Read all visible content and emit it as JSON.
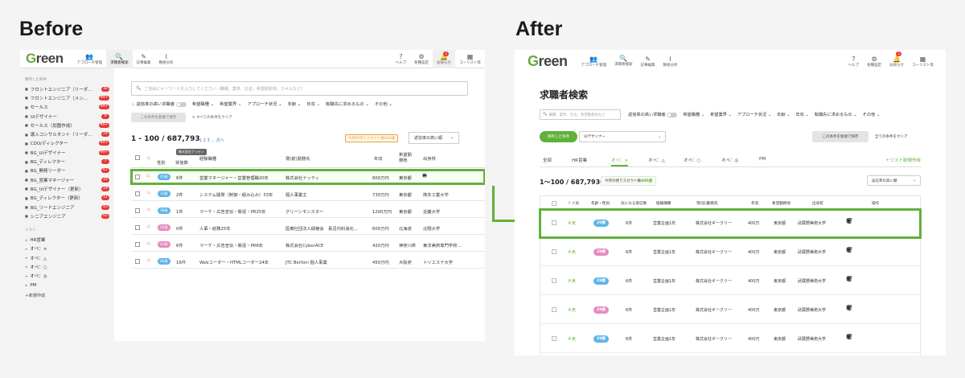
{
  "headings": {
    "before": "Before",
    "after": "After"
  },
  "before": {
    "nav": {
      "logo_g": "G",
      "logo_rest": "reen",
      "items": [
        {
          "label": "アプローチ管理",
          "icon": "people-icon"
        },
        {
          "label": "求職者検索",
          "icon": "search-icon",
          "active": true
        },
        {
          "label": "記事編集",
          "icon": "pen-icon"
        },
        {
          "label": "数値分析",
          "icon": "chart-icon"
        }
      ],
      "right": [
        {
          "label": "ヘルプ",
          "icon": "help-icon"
        },
        {
          "label": "各種設定",
          "icon": "gear-icon"
        },
        {
          "label": "お知らせ",
          "icon": "bell-icon",
          "badge": "2"
        },
        {
          "label": "コーリスト等",
          "icon": "building-icon"
        }
      ]
    },
    "sidebar": {
      "saved_heading": "保存した条件",
      "saved": [
        {
          "label": "フロントエンジニア（リーダ…",
          "count": "30"
        },
        {
          "label": "フロントエンジニア（メン…",
          "count": "99+"
        },
        {
          "label": "セールス",
          "count": "99+"
        },
        {
          "label": "UIデザイナー",
          "count": "9"
        },
        {
          "label": "セールス（加盟作成）",
          "count": "99+"
        },
        {
          "label": "導入コンサルタント（リーダ…",
          "count": "24"
        },
        {
          "label": "CDO/ディレクター",
          "count": "99+"
        },
        {
          "label": "BG_UIデザイナー",
          "count": "99+"
        },
        {
          "label": "BG_ディレクター",
          "count": "7"
        },
        {
          "label": "BG_開発リーダー",
          "count": "67"
        },
        {
          "label": "BG_営業マネージャー",
          "count": "31"
        },
        {
          "label": "BG_UIデザイナー（更新）",
          "count": "24"
        },
        {
          "label": "BG_ディレクター（更新）",
          "count": "11"
        },
        {
          "label": "BG_リードエンジニア",
          "count": "43"
        },
        {
          "label": "シニアエンジニア",
          "count": "62"
        }
      ],
      "list_heading": "リスト",
      "lists": [
        "HR営業",
        "オペ：×",
        "オペ：△",
        "オペ：○",
        "オペ：◎",
        "PM"
      ],
      "add_list": "＋新規作成"
    },
    "search_placeholder": "ご自由にキーワードを入力してください（職種、業界、社名、希望勤務地、スキルなど）",
    "filters": [
      "返信率の高い求職者",
      "希望職種 ⌄",
      "希望業界 ⌄",
      "アプローチ状況 ⌄",
      "年齢 ⌄",
      "年収 ⌄",
      "転職先に求めるもの ⌄",
      "その他 ⌄"
    ],
    "save_btn": "この条件を新規で保存",
    "clear": "すべての条件をクリア",
    "count": "1 - 100 / 687,793",
    "pager": "1 2 3 … 次へ",
    "scout": "今月の残りスカウト数400通",
    "sort": "返信率の高い順",
    "tooltip": "株式会社ナッティ",
    "header": {
      "sex": "性別",
      "received": "受信数",
      "job": "経験職種",
      "company": "現(前)勤務先",
      "salary": "年収",
      "location": "希望勤務地",
      "school": "出身校"
    },
    "rows": [
      {
        "age": "41歳",
        "pink": false,
        "count": "6件",
        "job": "営業マネージャー・営業管理職20年",
        "company": "株式会社ナッティ",
        "salary": "800万円",
        "loc": "東京都",
        "school": "",
        "highlight": true
      },
      {
        "age": "33歳",
        "pink": false,
        "count": "2件",
        "job": "システム開発（制御・組み込み）33年",
        "company": "個人事業主",
        "salary": "730万円",
        "loc": "東京都",
        "school": "熊本工業大学"
      },
      {
        "age": "38歳",
        "pink": false,
        "count": "1件",
        "job": "マーケ・広告宣伝・販促・PR25年",
        "company": "グリーンモンスター",
        "salary": "1200万円",
        "loc": "東京都",
        "school": "近畿大学"
      },
      {
        "age": "52歳",
        "pink": true,
        "count": "0件",
        "job": "人事・総務25年",
        "company": "医療社団法人緑稜会　長沼内科消化…",
        "salary": "600万円",
        "loc": "北海道",
        "school": "北翔大学"
      },
      {
        "age": "44歳",
        "pink": true,
        "count": "6件",
        "job": "マーケ・広告宣伝・販促・PR6年",
        "company": "株式会社CyberACE",
        "salary": "420万円",
        "loc": "神奈川県",
        "school": "東洋美術専門学校…"
      },
      {
        "age": "46歳",
        "pink": false,
        "count": "16件",
        "job": "Webコーダー・HTMLコーダー24年",
        "company": "JTC Berfoni 個人事業",
        "salary": "450万円",
        "loc": "大阪府",
        "school": "トリエステ大学"
      }
    ]
  },
  "after": {
    "nav": {
      "logo_g": "G",
      "logo_rest": "reen",
      "items": [
        {
          "label": "アプローチ管理",
          "icon": "people-icon"
        },
        {
          "label": "求職者検索",
          "icon": "search-icon",
          "active": true
        },
        {
          "label": "記事編集",
          "icon": "pen-icon"
        },
        {
          "label": "数値分析",
          "icon": "chart-icon"
        }
      ],
      "right": [
        {
          "label": "ヘルプ",
          "icon": "help-icon"
        },
        {
          "label": "各種設定",
          "icon": "gear-icon"
        },
        {
          "label": "お知らせ",
          "icon": "bell-icon",
          "badge": "2"
        },
        {
          "label": "コーリスト等",
          "icon": "building-icon"
        }
      ]
    },
    "title": "求職者検索",
    "search_placeholder": "職種、業界、社名、希望勤務地など",
    "filters": [
      "返信率の高い求職者",
      "希望職種 ⌄",
      "希望業界 ⌄",
      "アプローチ状況 ⌄",
      "年齢 ⌄",
      "年収 ⌄",
      "転職先に求めるもの ⌄",
      "その他 ⌄"
    ],
    "saved_btn": "保存した条件",
    "saved_select": "UIデザイナー",
    "save_btn": "この条件を新規で保存",
    "clear": "全ての条件をクリア",
    "tabs": [
      "全部",
      "HR営業",
      "オペ：×",
      "オペ：△",
      "オペ：○",
      "オペ：◎",
      "PM"
    ],
    "add_list": "＋リスト新規作成",
    "count": "1〜100 / 687,793件",
    "scout_pre": "今月の残りスカウト数",
    "scout_num": "400通",
    "sort": "返信率の高い順",
    "header": {
      "sex": "年齢・性別",
      "received": "気になる受信数",
      "job": "経験職種",
      "company": "現(前)勤務先",
      "salary": "年収",
      "location": "希望勤務地",
      "school": "出身校",
      "ops": "操作"
    },
    "popular": "人気",
    "rows": [
      {
        "age": "29歳",
        "pink": false,
        "count": "6件",
        "job": "営業企画1年",
        "company": "株式会社ギークリー",
        "salary": "400万",
        "loc": "東京都",
        "school": "武蔵野美術大学",
        "highlight": true
      },
      {
        "age": "29歳",
        "pink": true,
        "count": "6件",
        "job": "営業企画1年",
        "company": "株式会社ギークリー",
        "salary": "400万",
        "loc": "東京都",
        "school": "武蔵野美術大学"
      },
      {
        "age": "29歳",
        "pink": false,
        "count": "6件",
        "job": "営業企画1年",
        "company": "株式会社ギークリー",
        "salary": "400万",
        "loc": "東京都",
        "school": "武蔵野美術大学"
      },
      {
        "age": "29歳",
        "pink": true,
        "count": "6件",
        "job": "営業企画1年",
        "company": "株式会社ギークリー",
        "salary": "400万",
        "loc": "東京都",
        "school": "武蔵野美術大学"
      },
      {
        "age": "29歳",
        "pink": false,
        "count": "6件",
        "job": "営業企画1年",
        "company": "株式会社ギークリー",
        "salary": "400万",
        "loc": "東京都",
        "school": "武蔵野美術大学"
      }
    ]
  },
  "colors": {
    "accent": "#61b13a",
    "badge": "#e53935",
    "age_blue": "#5fb5e8",
    "age_pink": "#e58bbf"
  }
}
